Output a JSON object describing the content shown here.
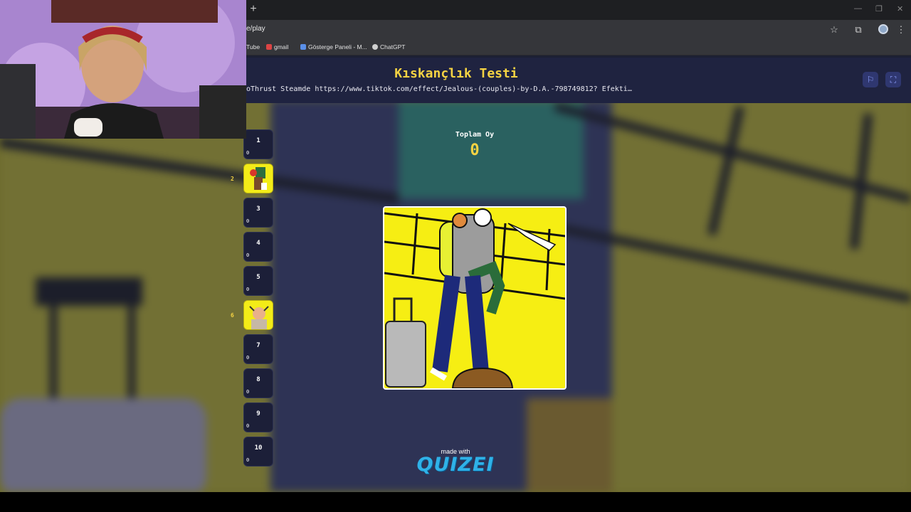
{
  "browser": {
    "new_tab_symbol": "+",
    "url": "e/play",
    "bookmarks": [
      {
        "label": "Tube",
        "color": "#e33"
      },
      {
        "label": "gmail",
        "color": "#d44"
      },
      {
        "label": "Gösterge Paneli - M...",
        "color": "#5a8fe8"
      },
      {
        "label": "ChatGPT",
        "color": "#cfcfcf"
      }
    ]
  },
  "quiz": {
    "title": "Kıskançlık Testi",
    "description": "oThrust Steamde https://www.tiktok.com/effect/Jealous-(couples)-by-D.A.-798749812? Efekti…",
    "total_votes_label": "Toplam Oy",
    "total_votes_value": "0",
    "made_with": "made with",
    "brand": "QUIZEI"
  },
  "ranks": [
    {
      "num": "1",
      "count": "0",
      "thumb": false
    },
    {
      "num": "2",
      "count": "",
      "thumb": true,
      "outside_num": "2",
      "outside_color": "#f5d343"
    },
    {
      "num": "3",
      "count": "0",
      "thumb": false
    },
    {
      "num": "4",
      "count": "0",
      "thumb": false
    },
    {
      "num": "5",
      "count": "0",
      "thumb": false
    },
    {
      "num": "6",
      "count": "",
      "thumb": true,
      "outside_num": "6",
      "outside_color": "#f5d343"
    },
    {
      "num": "7",
      "count": "0",
      "thumb": false
    },
    {
      "num": "8",
      "count": "0",
      "thumb": false
    },
    {
      "num": "9",
      "count": "0",
      "thumb": false
    },
    {
      "num": "10",
      "count": "0",
      "thumb": false
    }
  ],
  "colors": {
    "accent": "#f5d343",
    "header_bg": "#1f2340",
    "logo": "#2fb2e8",
    "card_yellow": "#f6ee13"
  }
}
